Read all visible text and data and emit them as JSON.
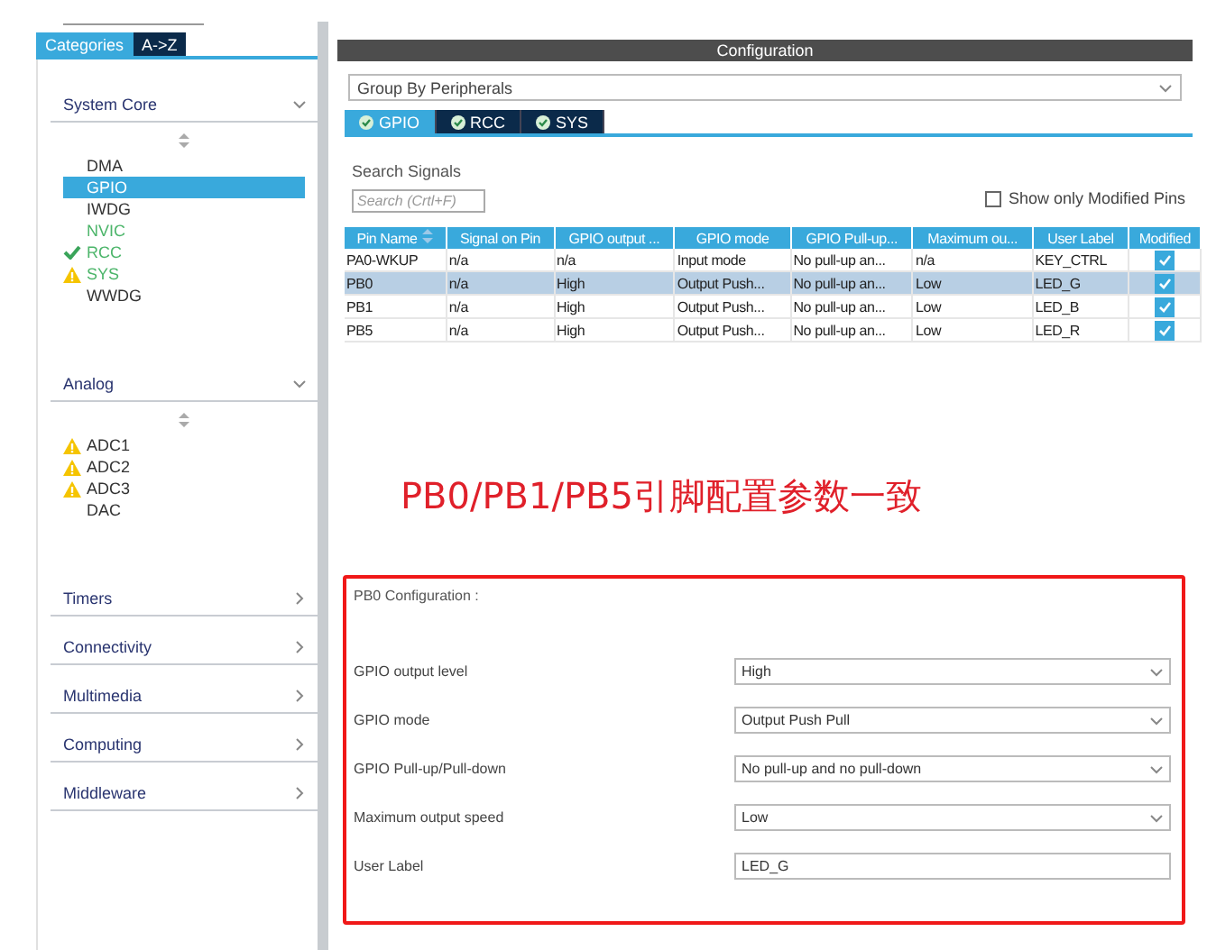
{
  "sidebar": {
    "tabs": [
      {
        "label": "Categories",
        "selected": true
      },
      {
        "label": "A->Z",
        "selected": false
      }
    ],
    "categories": [
      {
        "name": "System Core",
        "expanded": true,
        "items": [
          {
            "label": "DMA",
            "selected": false,
            "configured": false,
            "kind": "plain"
          },
          {
            "label": "GPIO",
            "selected": true,
            "configured": false,
            "kind": "plain"
          },
          {
            "label": "IWDG",
            "selected": false,
            "configured": false,
            "kind": "plain"
          },
          {
            "label": "NVIC",
            "selected": false,
            "configured": true,
            "kind": "plain"
          },
          {
            "label": "RCC",
            "selected": false,
            "configured": true,
            "kind": "check"
          },
          {
            "label": "SYS",
            "selected": false,
            "configured": true,
            "kind": "warning"
          },
          {
            "label": "WWDG",
            "selected": false,
            "configured": false,
            "kind": "plain"
          }
        ]
      },
      {
        "name": "Analog",
        "expanded": true,
        "items": [
          {
            "label": "ADC1",
            "selected": false,
            "configured": false,
            "kind": "warning"
          },
          {
            "label": "ADC2",
            "selected": false,
            "configured": false,
            "kind": "warning"
          },
          {
            "label": "ADC3",
            "selected": false,
            "configured": false,
            "kind": "warning"
          },
          {
            "label": "DAC",
            "selected": false,
            "configured": false,
            "kind": "plain"
          }
        ]
      },
      {
        "name": "Timers",
        "expanded": false
      },
      {
        "name": "Connectivity",
        "expanded": false
      },
      {
        "name": "Multimedia",
        "expanded": false
      },
      {
        "name": "Computing",
        "expanded": false
      },
      {
        "name": "Middleware",
        "expanded": false
      }
    ]
  },
  "main": {
    "title": "Configuration",
    "group_select": "Group By Peripherals",
    "tabs": [
      {
        "label": "GPIO",
        "selected": true
      },
      {
        "label": "RCC",
        "selected": false
      },
      {
        "label": "SYS",
        "selected": false
      }
    ],
    "search_label": "Search Signals",
    "search": {
      "placeholder": "Search (Crtl+F)"
    },
    "show_modified": {
      "label": "Show only Modified Pins",
      "checked": false
    },
    "table": {
      "columns": [
        "Pin Name",
        "Signal on Pin",
        "GPIO output ...",
        "GPIO mode",
        "GPIO Pull-up...",
        "Maximum ou...",
        "User Label",
        "Modified"
      ],
      "rows": [
        {
          "cells": [
            "PA0-WKUP",
            "n/a",
            "n/a",
            "Input mode",
            "No pull-up an...",
            "n/a",
            "KEY_CTRL"
          ],
          "modified": true,
          "selected": false
        },
        {
          "cells": [
            "PB0",
            "n/a",
            "High",
            "Output Push...",
            "No pull-up an...",
            "Low",
            "LED_G"
          ],
          "modified": true,
          "selected": true
        },
        {
          "cells": [
            "PB1",
            "n/a",
            "High",
            "Output Push...",
            "No pull-up an...",
            "Low",
            "LED_B"
          ],
          "modified": true,
          "selected": false
        },
        {
          "cells": [
            "PB5",
            "n/a",
            "High",
            "Output Push...",
            "No pull-up an...",
            "Low",
            "LED_R"
          ],
          "modified": true,
          "selected": false
        }
      ]
    },
    "annotation": "PB0/PB1/PB5引脚配置参数一致",
    "config": {
      "title": "PB0 Configuration :",
      "fields": [
        {
          "label": "GPIO output level",
          "value": "High",
          "kind": "select"
        },
        {
          "label": "GPIO mode",
          "value": "Output Push Pull",
          "kind": "select"
        },
        {
          "label": "GPIO Pull-up/Pull-down",
          "value": "No pull-up and no pull-down",
          "kind": "select"
        },
        {
          "label": "Maximum output speed",
          "value": "Low",
          "kind": "select"
        },
        {
          "label": "User Label",
          "value": "LED_G",
          "kind": "text"
        }
      ]
    }
  }
}
